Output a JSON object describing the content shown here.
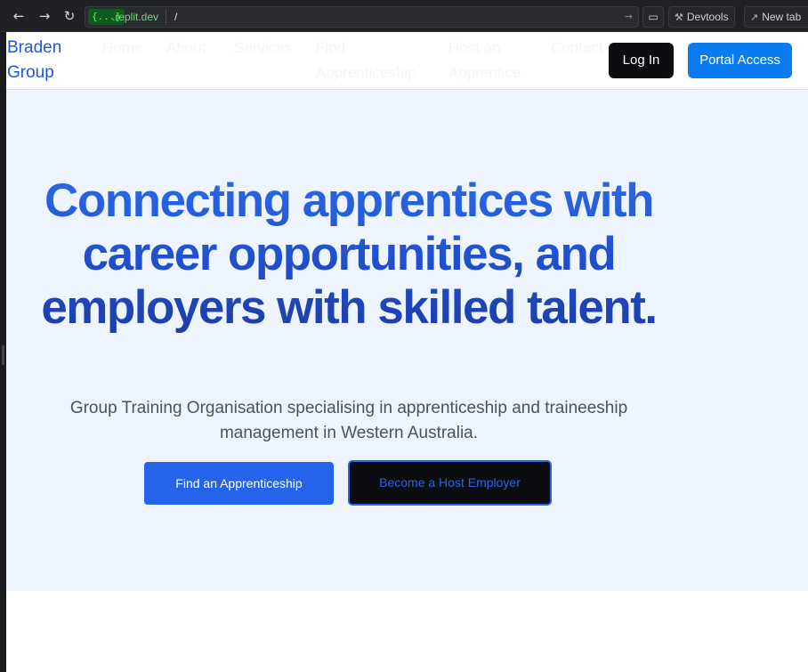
{
  "browser": {
    "back_icon": "arrow-left-icon",
    "forward_icon": "arrow-right-icon",
    "reload_icon": "reload-icon",
    "url_badge": "{...}",
    "url_host": ".replit.dev",
    "url_path": "/",
    "devtools_label": "Devtools",
    "newtab_label": "New tab"
  },
  "header": {
    "brand_line1": "Braden",
    "brand_line2": "Group",
    "nav": {
      "home": "Home",
      "about": "About",
      "services": "Services",
      "find_line1": "Find",
      "find_line2": "Apprenticeship",
      "host_line1": "Host an",
      "host_line2": "Apprentice",
      "contact": "Contact"
    },
    "login_label": "Log In",
    "portal_label": "Portal Access"
  },
  "hero": {
    "title": "Connecting apprentices with career opportunities, and employers with skilled talent.",
    "subtitle": "Group Training Organisation specialising in apprenticeship and traineeship management in Western Australia.",
    "primary_cta": "Find an Apprenticeship",
    "secondary_cta": "Become a Host Employer"
  },
  "colors": {
    "brand_blue": "#1f56d6",
    "portal_button": "#0a7cf0",
    "cta_blue": "#2563eb",
    "hero_background": "#eef4fd",
    "dark_button": "#0c0d10"
  }
}
